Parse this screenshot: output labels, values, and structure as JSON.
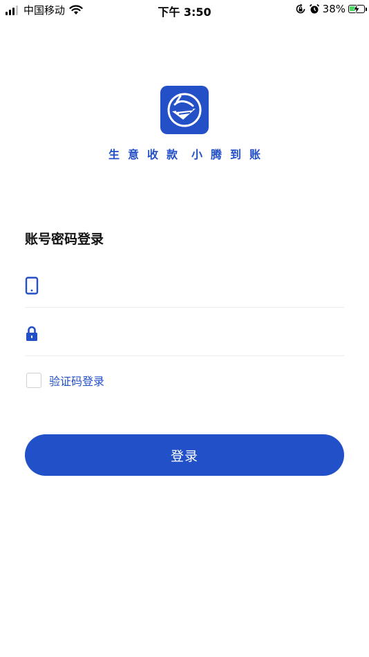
{
  "status_bar": {
    "carrier": "中国移动",
    "time": "下午 3:50",
    "battery": "38%"
  },
  "branding": {
    "slogan_left": "生意收款",
    "slogan_right": "小腾到账"
  },
  "login": {
    "title": "账号密码登录",
    "phone_placeholder": "",
    "password_placeholder": "",
    "code_login_label": "验证码登录",
    "code_login_checked": false,
    "submit_label": "登录"
  },
  "colors": {
    "brand_blue": "#2450c7",
    "button_blue": "#2150c8",
    "battery_green": "#4cd964",
    "divider": "#ececec"
  },
  "icons": [
    "signal-icon",
    "wifi-icon",
    "rotation-lock-icon",
    "alarm-icon",
    "battery-icon",
    "app-logo-icon",
    "phone-icon",
    "lock-icon"
  ]
}
